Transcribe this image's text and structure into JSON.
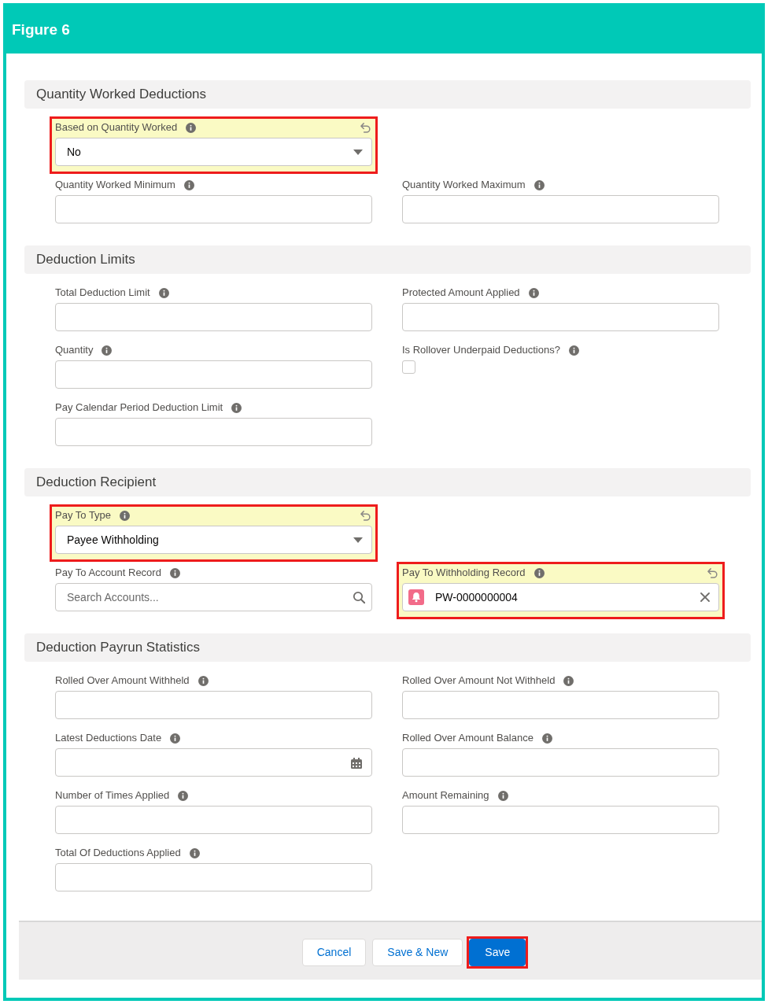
{
  "figure": {
    "title": "Figure 6"
  },
  "sections": [
    {
      "title": "Quantity Worked Deductions",
      "rows": [
        [
          {
            "kind": "select",
            "label": "Based on Quantity Worked",
            "value": "No",
            "edited": true,
            "highlighted": true
          }
        ],
        [
          {
            "kind": "text",
            "label": "Quantity Worked Minimum",
            "edited": false,
            "highlighted": false
          },
          {
            "kind": "text",
            "label": "Quantity Worked Maximum",
            "edited": false,
            "highlighted": false
          }
        ]
      ]
    },
    {
      "title": "Deduction Limits",
      "rows": [
        [
          {
            "kind": "text",
            "label": "Total Deduction Limit",
            "edited": false,
            "highlighted": false
          },
          {
            "kind": "text",
            "label": "Protected Amount Applied",
            "edited": false,
            "highlighted": false
          }
        ],
        [
          {
            "kind": "text",
            "label": "Quantity",
            "edited": false,
            "highlighted": false
          },
          {
            "kind": "checkbox",
            "label": "Is Rollover Underpaid Deductions?",
            "checked": false,
            "edited": false,
            "highlighted": false
          }
        ],
        [
          {
            "kind": "text",
            "label": "Pay Calendar Period Deduction Limit",
            "edited": false,
            "highlighted": false
          }
        ]
      ]
    },
    {
      "title": "Deduction Recipient",
      "rows": [
        [
          {
            "kind": "select",
            "label": "Pay To Type",
            "value": "Payee Withholding",
            "edited": true,
            "highlighted": true
          }
        ],
        [
          {
            "kind": "lookup",
            "label": "Pay To Account Record",
            "placeholder": "Search Accounts...",
            "edited": false,
            "highlighted": false
          },
          {
            "kind": "record",
            "label": "Pay To Withholding Record",
            "value": "PW-0000000004",
            "edited": true,
            "highlighted": true
          }
        ]
      ]
    },
    {
      "title": "Deduction Payrun Statistics",
      "rows": [
        [
          {
            "kind": "text",
            "label": "Rolled Over Amount Withheld",
            "edited": false,
            "highlighted": false
          },
          {
            "kind": "text",
            "label": "Rolled Over Amount Not Withheld",
            "edited": false,
            "highlighted": false
          }
        ],
        [
          {
            "kind": "date",
            "label": "Latest Deductions Date",
            "edited": false,
            "highlighted": false
          },
          {
            "kind": "text",
            "label": "Rolled Over Amount Balance",
            "edited": false,
            "highlighted": false
          }
        ],
        [
          {
            "kind": "text",
            "label": "Number of Times Applied",
            "edited": false,
            "highlighted": false
          },
          {
            "kind": "text",
            "label": "Amount Remaining",
            "edited": false,
            "highlighted": false
          }
        ],
        [
          {
            "kind": "text",
            "label": "Total Of Deductions Applied",
            "edited": false,
            "highlighted": false
          }
        ]
      ]
    }
  ],
  "footer": {
    "buttons": [
      {
        "label": "Cancel",
        "kind": "neutral",
        "highlighted": false
      },
      {
        "label": "Save & New",
        "kind": "neutral",
        "highlighted": false
      },
      {
        "label": "Save",
        "kind": "brand",
        "highlighted": true
      }
    ]
  }
}
